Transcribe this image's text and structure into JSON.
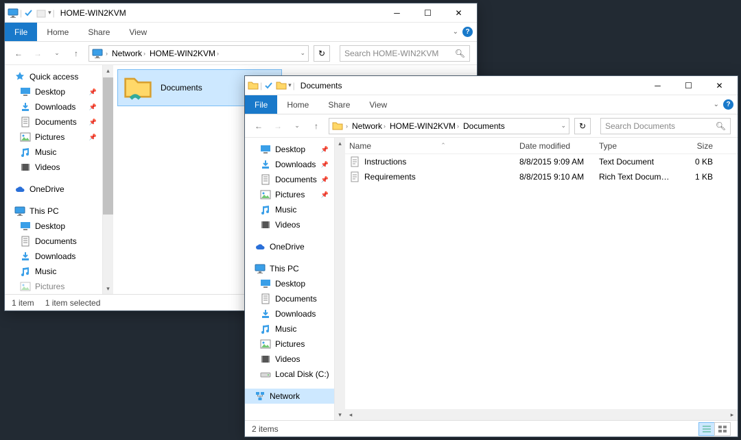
{
  "win1": {
    "title": "HOME-WIN2KVM",
    "tabs": {
      "file": "File",
      "home": "Home",
      "share": "Share",
      "view": "View"
    },
    "path": [
      "Network",
      "HOME-WIN2KVM"
    ],
    "search_placeholder": "Search HOME-WIN2KVM",
    "nav": {
      "quick": "Quick access",
      "desktop": "Desktop",
      "downloads": "Downloads",
      "documents": "Documents",
      "pictures": "Pictures",
      "music": "Music",
      "videos": "Videos",
      "onedrive": "OneDrive",
      "thispc": "This PC",
      "pc_desktop": "Desktop",
      "pc_documents": "Documents",
      "pc_downloads": "Downloads",
      "pc_music": "Music",
      "pc_pictures": "Pictures"
    },
    "folder_tile": "Documents",
    "status_left": "1 item",
    "status_right": "1 item selected"
  },
  "win2": {
    "title": "Documents",
    "tabs": {
      "file": "File",
      "home": "Home",
      "share": "Share",
      "view": "View"
    },
    "path": [
      "Network",
      "HOME-WIN2KVM",
      "Documents"
    ],
    "search_placeholder": "Search Documents",
    "nav": {
      "desktop": "Desktop",
      "downloads": "Downloads",
      "documents": "Documents",
      "pictures": "Pictures",
      "music": "Music",
      "videos": "Videos",
      "onedrive": "OneDrive",
      "thispc": "This PC",
      "pc_desktop": "Desktop",
      "pc_documents": "Documents",
      "pc_downloads": "Downloads",
      "pc_music": "Music",
      "pc_pictures": "Pictures",
      "pc_videos": "Videos",
      "pc_localdisk": "Local Disk (C:)",
      "network": "Network"
    },
    "cols": {
      "name": "Name",
      "date": "Date modified",
      "type": "Type",
      "size": "Size"
    },
    "files": [
      {
        "name": "Instructions",
        "date": "8/8/2015 9:09 AM",
        "type": "Text Document",
        "size": "0 KB"
      },
      {
        "name": "Requirements",
        "date": "8/8/2015 9:10 AM",
        "type": "Rich Text Document",
        "size": "1 KB"
      }
    ],
    "status": "2 items"
  }
}
